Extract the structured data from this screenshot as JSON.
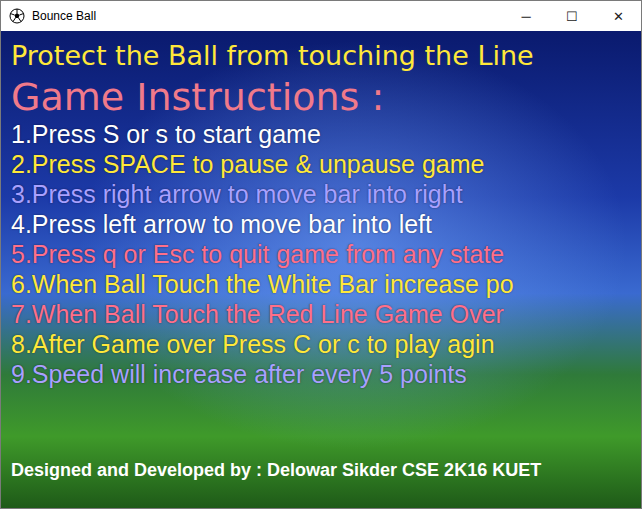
{
  "window": {
    "title": "Bounce Ball",
    "controls": [
      "─",
      "☐",
      "✕"
    ]
  },
  "heading": {
    "text": "Protect the Ball from touching the Line",
    "color": "#ffe83a"
  },
  "instructions_title": {
    "text": "Game Instructions :",
    "color": "#f07a8a"
  },
  "instructions": [
    {
      "text": "1.Press S or s to start game",
      "color": "#ffffff"
    },
    {
      "text": "2.Press SPACE to pause & unpause game",
      "color": "#ffe83a"
    },
    {
      "text": "3.Press right arrow to move bar into right",
      "color": "#a8a0ff"
    },
    {
      "text": "4.Press left arrow to move bar into left",
      "color": "#ffffff"
    },
    {
      "text": "5.Press q or Esc to quit game from any state",
      "color": "#ff6f8a"
    },
    {
      "text": "6.When Ball Touch the White Bar increase po",
      "color": "#ffe83a"
    },
    {
      "text": "7.When Ball Touch the Red Line Game Over",
      "color": "#ff6f8a"
    },
    {
      "text": "8.After Game over Press C or c to play agin",
      "color": "#ffe83a"
    },
    {
      "text": "9.Speed will increase after every 5 points",
      "color": "#a8a0ff"
    }
  ],
  "credits": "Designed and Developed by : Delowar Sikder CSE 2K16 KUET"
}
